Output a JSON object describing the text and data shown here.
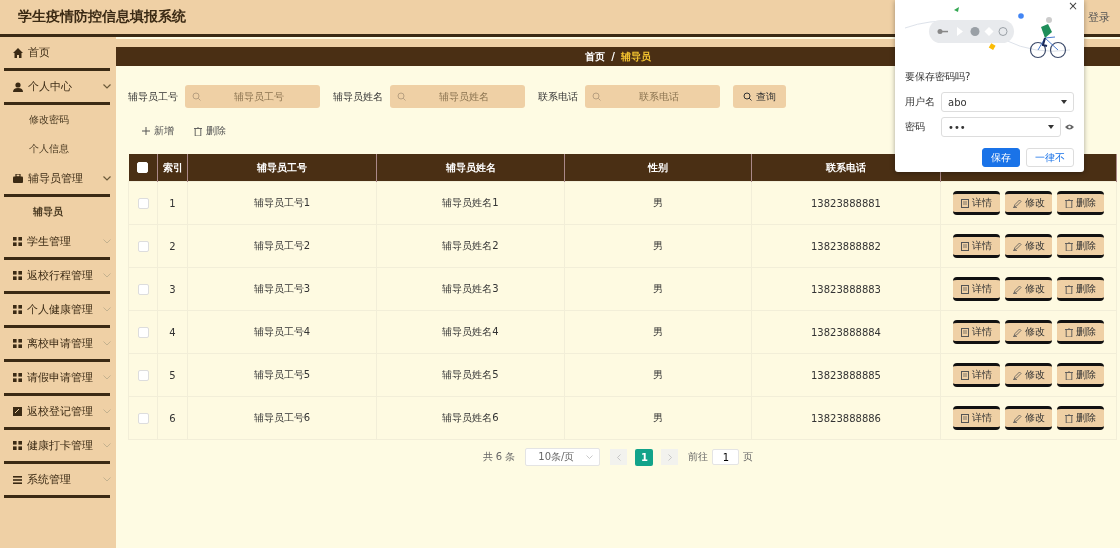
{
  "header": {
    "title": "学生疫情防控信息填报系统",
    "user_link": "登录"
  },
  "sidebar": {
    "items": [
      {
        "label": "首页",
        "kind": "home",
        "collapsible": false
      },
      {
        "label": "个人中心",
        "kind": "user",
        "collapsible": true,
        "expanded": true,
        "children": [
          {
            "label": "修改密码",
            "selected": false
          },
          {
            "label": "个人信息",
            "selected": false
          }
        ]
      },
      {
        "label": "辅导员管理",
        "kind": "bag",
        "collapsible": true,
        "expanded": true,
        "children": [
          {
            "label": "辅导员",
            "selected": true
          }
        ]
      },
      {
        "label": "学生管理",
        "kind": "grid",
        "collapsible": true,
        "expanded": false
      },
      {
        "label": "返校行程管理",
        "kind": "grid",
        "collapsible": true,
        "expanded": false
      },
      {
        "label": "个人健康管理",
        "kind": "grid",
        "collapsible": true,
        "expanded": false
      },
      {
        "label": "离校申请管理",
        "kind": "grid",
        "collapsible": true,
        "expanded": false
      },
      {
        "label": "请假申请管理",
        "kind": "grid",
        "collapsible": true,
        "expanded": false
      },
      {
        "label": "返校登记管理",
        "kind": "note",
        "collapsible": true,
        "expanded": false
      },
      {
        "label": "健康打卡管理",
        "kind": "grid",
        "collapsible": true,
        "expanded": false
      },
      {
        "label": "系统管理",
        "kind": "menu",
        "collapsible": true,
        "expanded": false
      }
    ]
  },
  "breadcrumb": {
    "items": [
      "首页",
      "辅导员"
    ],
    "separator": "/"
  },
  "search": {
    "fields": [
      {
        "label": "辅导员工号",
        "placeholder": "辅导员工号"
      },
      {
        "label": "辅导员姓名",
        "placeholder": "辅导员姓名"
      },
      {
        "label": "联系电话",
        "placeholder": "联系电话"
      }
    ],
    "button": "查询"
  },
  "actions": [
    {
      "kind": "add",
      "label": "新增"
    },
    {
      "kind": "delete",
      "label": "删除"
    }
  ],
  "table": {
    "select_all": false,
    "columns": [
      "索引",
      "辅导员工号",
      "辅导员姓名",
      "性别",
      "联系电话"
    ],
    "rows": [
      {
        "checked": false,
        "cells": [
          "1",
          "辅导员工号1",
          "辅导员姓名1",
          "男",
          "13823888881"
        ],
        "actions": [
          "详情",
          "修改",
          "删除"
        ]
      },
      {
        "checked": false,
        "cells": [
          "2",
          "辅导员工号2",
          "辅导员姓名2",
          "男",
          "13823888882"
        ],
        "actions": [
          "详情",
          "修改",
          "删除"
        ]
      },
      {
        "checked": false,
        "cells": [
          "3",
          "辅导员工号3",
          "辅导员姓名3",
          "男",
          "13823888883"
        ],
        "actions": [
          "详情",
          "修改",
          "删除"
        ]
      },
      {
        "checked": false,
        "cells": [
          "4",
          "辅导员工号4",
          "辅导员姓名4",
          "男",
          "13823888884"
        ],
        "actions": [
          "详情",
          "修改",
          "删除"
        ]
      },
      {
        "checked": false,
        "cells": [
          "5",
          "辅导员工号5",
          "辅导员姓名5",
          "男",
          "13823888885"
        ],
        "actions": [
          "详情",
          "修改",
          "删除"
        ]
      },
      {
        "checked": false,
        "cells": [
          "6",
          "辅导员工号6",
          "辅导员姓名6",
          "男",
          "13823888886"
        ],
        "actions": [
          "详情",
          "修改",
          "删除"
        ]
      }
    ]
  },
  "pagination": {
    "total": "共 6 条",
    "page_size": "10条/页",
    "pages": [
      {
        "label": "1",
        "selected": true
      }
    ],
    "goto_label": "前往",
    "goto_value": "1",
    "goto_suffix": "页"
  },
  "save_password_popup": {
    "close": "×",
    "title": "要保存密码吗?",
    "username_label": "用户名",
    "username": "abo",
    "password_label": "密码",
    "password": "•••",
    "buttons": [
      {
        "kind": "primary",
        "label": "保存"
      },
      {
        "kind": "secondary",
        "label": "一律不"
      }
    ]
  }
}
